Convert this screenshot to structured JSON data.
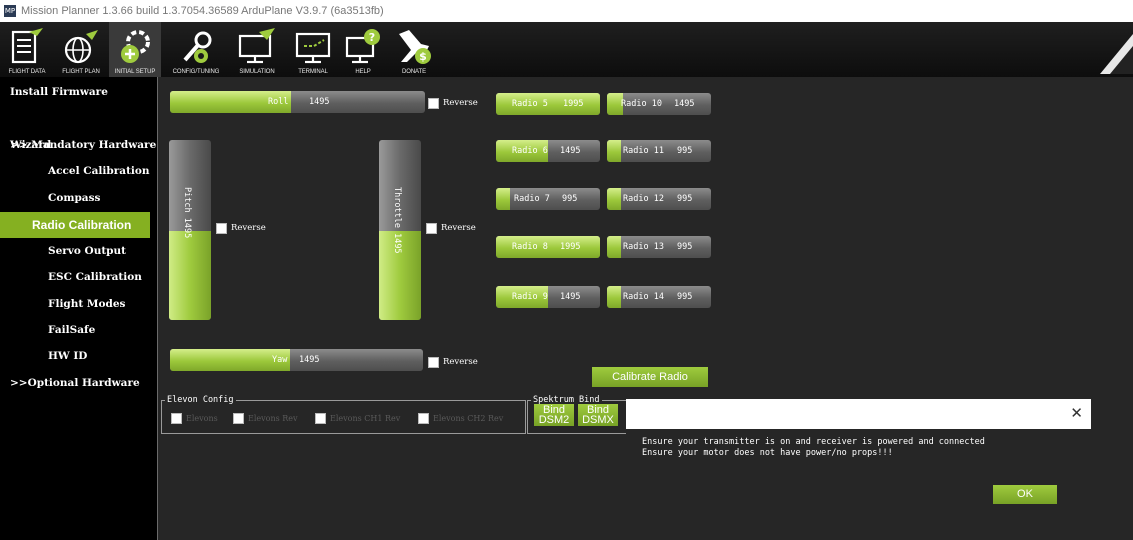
{
  "window": {
    "app_icon": "MP",
    "title": "Mission Planner 1.3.66 build 1.3.7054.36589 ArduPlane V3.9.7 (6a3513fb)"
  },
  "toolbar": {
    "buttons": [
      {
        "label": "FLIGHT DATA",
        "icon": "flight-data-icon"
      },
      {
        "label": "FLIGHT PLAN",
        "icon": "flight-plan-icon"
      },
      {
        "label": "INITIAL SETUP",
        "icon": "initial-setup-icon",
        "active": true
      },
      {
        "label": "CONFIG/TUNING",
        "icon": "config-tuning-icon"
      },
      {
        "label": "SIMULATION",
        "icon": "simulation-icon"
      },
      {
        "label": "TERMINAL",
        "icon": "terminal-icon"
      },
      {
        "label": "HELP",
        "icon": "help-icon"
      },
      {
        "label": "DONATE",
        "icon": "donate-icon"
      }
    ]
  },
  "sidebar": {
    "items": [
      {
        "label": "Install Firmware"
      },
      {
        "label": "Wizard"
      },
      {
        "label": ">> Mandatory Hardware"
      },
      {
        "label": "Accel Calibration"
      },
      {
        "label": "Compass"
      },
      {
        "label": "Radio Calibration",
        "selected": true
      },
      {
        "label": "Servo Output"
      },
      {
        "label": "ESC Calibration"
      },
      {
        "label": "Flight Modes"
      },
      {
        "label": "FailSafe"
      },
      {
        "label": "HW ID"
      },
      {
        "label": ">>Optional Hardware"
      }
    ]
  },
  "radio": {
    "roll": {
      "label": "Roll",
      "value": "1495",
      "fill_fraction": 0.475
    },
    "pitch": {
      "label": "Pitch",
      "value": "1495",
      "fill_fraction": 0.495
    },
    "throttle": {
      "label": "Throttle",
      "value": "1495",
      "fill_fraction": 0.495
    },
    "yaw": {
      "label": "Yaw",
      "value": "1495",
      "fill_fraction": 0.475
    },
    "reverse_label": "Reverse",
    "channels": [
      {
        "label": "Radio 5",
        "value": "1995",
        "fill_fraction": 1.0
      },
      {
        "label": "Radio 6",
        "value": "1495",
        "fill_fraction": 0.5
      },
      {
        "label": "Radio 7",
        "value": "995",
        "fill_fraction": 0.13
      },
      {
        "label": "Radio 8",
        "value": "1995",
        "fill_fraction": 1.0
      },
      {
        "label": "Radio 9",
        "value": "1495",
        "fill_fraction": 0.5
      },
      {
        "label": "Radio 10",
        "value": "1495",
        "fill_fraction": 0.15
      },
      {
        "label": "Radio 11",
        "value": "995",
        "fill_fraction": 0.13
      },
      {
        "label": "Radio 12",
        "value": "995",
        "fill_fraction": 0.13
      },
      {
        "label": "Radio 13",
        "value": "995",
        "fill_fraction": 0.13
      },
      {
        "label": "Radio 14",
        "value": "995",
        "fill_fraction": 0.13
      }
    ],
    "calibrate_label": "Calibrate Radio"
  },
  "elevon": {
    "title": "Elevon Config",
    "options": [
      "Elevons",
      "Elevons Rev",
      "Elevons CH1 Rev",
      "Elevons CH2 Rev"
    ]
  },
  "spektrum": {
    "title": "Spektrum Bind",
    "buttons": [
      "Bind DSM2",
      "Bind DSMX"
    ]
  },
  "dialog": {
    "close_symbol": "✕",
    "message_line1": "Ensure your transmitter is on and receiver is powered and connected",
    "message_line2": "Ensure your motor does not have power/no props!!!",
    "ok_label": "OK"
  },
  "colors": {
    "accent": "#85b021",
    "background": "#262626",
    "sidebar": "#000000"
  }
}
